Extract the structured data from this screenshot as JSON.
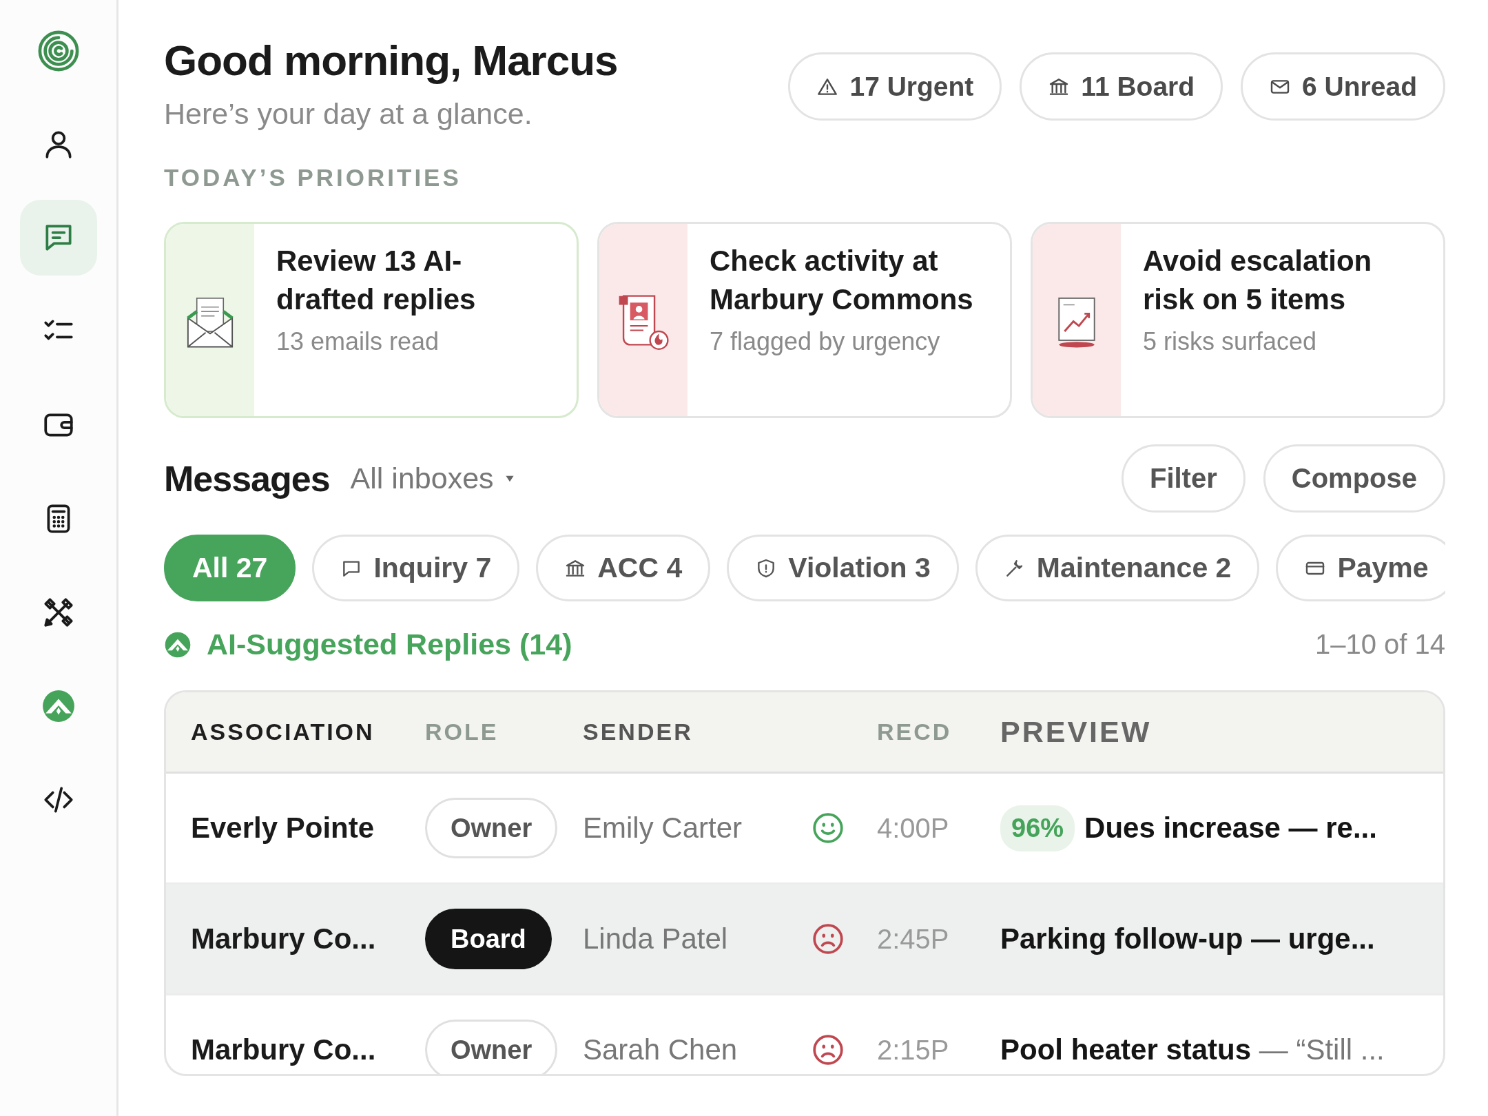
{
  "sidebar": {
    "items": [
      {
        "selected": false
      },
      {
        "selected": true
      },
      {
        "selected": false
      },
      {
        "selected": false
      },
      {
        "selected": false
      },
      {
        "selected": false
      },
      {
        "selected": false
      },
      {
        "selected": false
      }
    ]
  },
  "header": {
    "greeting": "Good morning, Marcus",
    "subtitle": "Here’s your day at a glance.",
    "stats": [
      {
        "label": "17 Urgent"
      },
      {
        "label": "11 Board"
      },
      {
        "label": "6 Unread"
      }
    ]
  },
  "priorities": {
    "title": "TODAY’S PRIORITIES",
    "cards": [
      {
        "kind": "positive",
        "title": "Review 13 AI-drafted replies",
        "subtitle": "13 emails read"
      },
      {
        "kind": "alert",
        "title": "Check activity at Marbury Commons",
        "subtitle": "7 flagged by urgency"
      },
      {
        "kind": "alert",
        "title": "Avoid escalation risk on 5 items",
        "subtitle": "5 risks surfaced"
      }
    ]
  },
  "messages": {
    "title": "Messages",
    "inbox": "All inboxes",
    "buttons": [
      "Filter",
      "Compose"
    ],
    "filters": [
      {
        "label": "All 27",
        "selected": true
      },
      {
        "label": "Inquiry 7",
        "selected": false
      },
      {
        "label": "ACC 4",
        "selected": false
      },
      {
        "label": "Violation 3",
        "selected": false
      },
      {
        "label": "Maintenance 2",
        "selected": false
      },
      {
        "label": "Payme",
        "selected": false
      }
    ],
    "section": "AI-Suggested Replies (14)",
    "range": "1–10 of 14"
  },
  "table": {
    "columns": [
      "ASSOCIATION",
      "ROLE",
      "SENDER",
      "RECD",
      "PREVIEW"
    ],
    "rows": [
      {
        "association": "Everly Pointe",
        "role": "Owner",
        "role_filled": false,
        "sender": "Emily Carter",
        "satisfied": true,
        "time": "4:00P",
        "confidence": "96%",
        "preview": "Dues increase — re...",
        "unread": true,
        "selected": false
      },
      {
        "association": "Marbury Co...",
        "role": "Board",
        "role_filled": true,
        "sender": "Linda Patel",
        "satisfied": false,
        "time": "2:45P",
        "preview": "Parking follow-up — urge...",
        "unread": true,
        "selected": true
      },
      {
        "association": "Marbury Co...",
        "role": "Owner",
        "role_filled": false,
        "sender": "Sarah Chen",
        "satisfied": false,
        "time": "2:15P",
        "preview": "**Pool heater status** — “Still ...",
        "unread": false,
        "selected": false
      }
    ]
  }
}
